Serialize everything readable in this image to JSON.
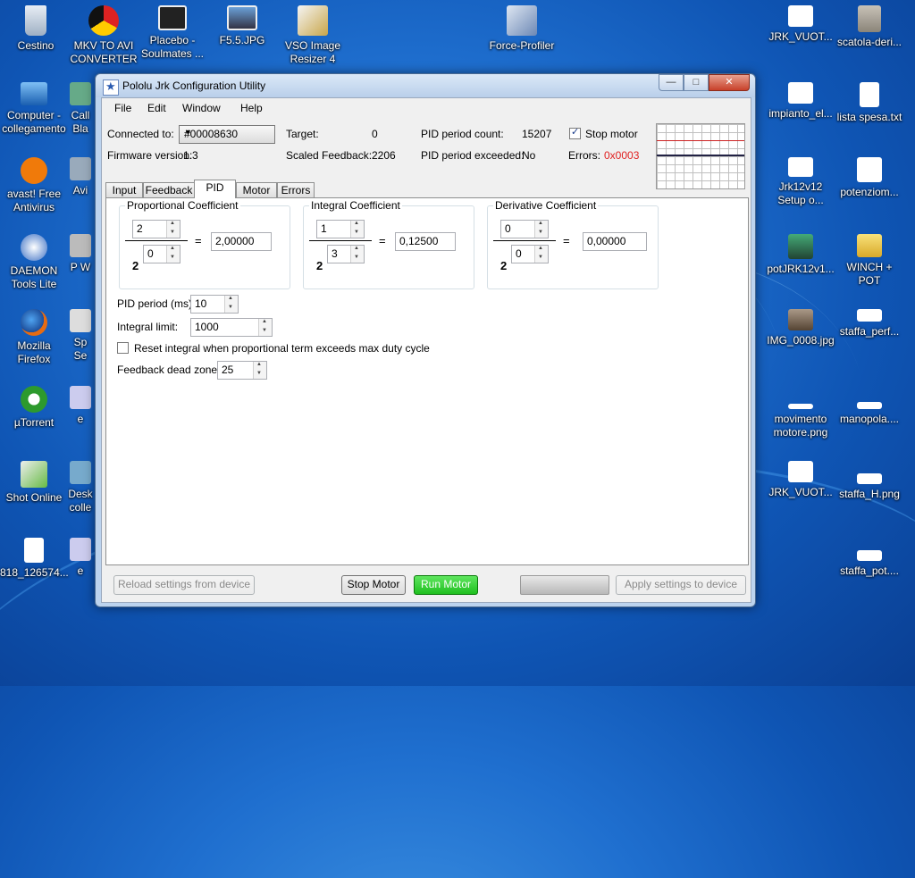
{
  "desktop": {
    "icons": [
      {
        "label": "Cestino",
        "icon": "recycle-bin-icon"
      },
      {
        "label": "MKV TO AVI CONVERTER",
        "icon": "mkv-converter-icon"
      },
      {
        "label": "Placebo - Soulmates ...",
        "icon": "video-file-icon"
      },
      {
        "label": "F5.5.JPG",
        "icon": "image-file-icon"
      },
      {
        "label": "VSO Image Resizer 4",
        "icon": "vso-image-resizer-icon"
      },
      {
        "label": "Force-Profiler",
        "icon": "force-profiler-icon"
      },
      {
        "label": "JRK_VUOT...",
        "icon": "image-file-icon"
      },
      {
        "label": "scatola-deri...",
        "icon": "image-file-icon"
      },
      {
        "label": "Computer - collegamento",
        "icon": "computer-icon"
      },
      {
        "label": "Call Bla",
        "icon": "shortcut-icon"
      },
      {
        "label": "impianto_el...",
        "icon": "image-file-icon"
      },
      {
        "label": "lista spesa.txt",
        "icon": "text-file-icon"
      },
      {
        "label": "avast! Free Antivirus",
        "icon": "avast-icon"
      },
      {
        "label": "Avi",
        "icon": "shortcut-icon"
      },
      {
        "label": "Jrk12v12 Setup o...",
        "icon": "setup-icon"
      },
      {
        "label": "potenziom...",
        "icon": "image-file-icon"
      },
      {
        "label": "DAEMON Tools Lite",
        "icon": "daemon-tools-icon"
      },
      {
        "label": "P W",
        "icon": "shortcut-icon"
      },
      {
        "label": "potJRK12v1...",
        "icon": "image-file-icon"
      },
      {
        "label": "WINCH + POT",
        "icon": "folder-icon"
      },
      {
        "label": "Mozilla Firefox",
        "icon": "firefox-icon"
      },
      {
        "label": "Sp Se",
        "icon": "shortcut-icon"
      },
      {
        "label": "IMG_0008.jpg",
        "icon": "image-file-icon"
      },
      {
        "label": "staffa_perf...",
        "icon": "image-file-icon"
      },
      {
        "label": "µTorrent",
        "icon": "utorrent-icon"
      },
      {
        "label": "e",
        "icon": "shortcut-icon"
      },
      {
        "label": "movimento motore.png",
        "icon": "image-file-icon"
      },
      {
        "label": "manopola....",
        "icon": "image-file-icon"
      },
      {
        "label": "Shot Online",
        "icon": "shot-online-icon"
      },
      {
        "label": "Desk colle",
        "icon": "shortcut-icon"
      },
      {
        "label": "JRK_VUOT...",
        "icon": "image-file-icon"
      },
      {
        "label": "staffa_H.png",
        "icon": "image-file-icon"
      },
      {
        "label": "818_126574...",
        "icon": "mp3-file-icon"
      },
      {
        "label": "e",
        "icon": "shortcut-icon"
      },
      {
        "label": "staffa_pot....",
        "icon": "image-file-icon"
      }
    ]
  },
  "window": {
    "title": "Pololu Jrk Configuration Utility",
    "controls": [
      "minimize",
      "maximize",
      "close"
    ]
  },
  "menu": {
    "file": "File",
    "edit": "Edit",
    "window": "Window",
    "help": "Help"
  },
  "status": {
    "connected_label": "Connected to:",
    "connected_value": "#00008630",
    "firmware_label": "Firmware version:",
    "firmware_value": "1.3",
    "target_label": "Target:",
    "target_value": "0",
    "scaled_feedback_label": "Scaled Feedback:",
    "scaled_feedback_value": "2206",
    "pid_count_label": "PID period count:",
    "pid_count_value": "15207",
    "pid_exceeded_label": "PID period exceeded:",
    "pid_exceeded_value": "No",
    "stop_motor_label": "Stop motor",
    "stop_motor_checked": true,
    "errors_label": "Errors:",
    "errors_value": "0x0003",
    "errors_color": "#e02020"
  },
  "tabs": [
    {
      "label": "Input",
      "active": false
    },
    {
      "label": "Feedback",
      "active": false
    },
    {
      "label": "PID",
      "active": true
    },
    {
      "label": "Motor",
      "active": false
    },
    {
      "label": "Errors",
      "active": false
    }
  ],
  "pid": {
    "proportional": {
      "title": "Proportional Coefficient",
      "multiplier": "2",
      "exponent": "0",
      "base": "2",
      "result": "2,00000"
    },
    "integral": {
      "title": "Integral Coefficient",
      "multiplier": "1",
      "exponent": "3",
      "base": "2",
      "result": "0,12500"
    },
    "derivative": {
      "title": "Derivative Coefficient",
      "multiplier": "0",
      "exponent": "0",
      "base": "2",
      "result": "0,00000"
    },
    "equals": "=",
    "period_label": "PID period (ms):",
    "period_value": "10",
    "integral_limit_label": "Integral limit:",
    "integral_limit_value": "1000",
    "reset_integral_label": "Reset integral when proportional term exceeds max duty cycle",
    "reset_integral_checked": false,
    "dead_zone_label": "Feedback dead zone:",
    "dead_zone_value": "25"
  },
  "footer": {
    "reload": "Reload settings from device",
    "stop_motor": "Stop Motor",
    "run_motor": "Run Motor",
    "apply": "Apply settings to device"
  }
}
